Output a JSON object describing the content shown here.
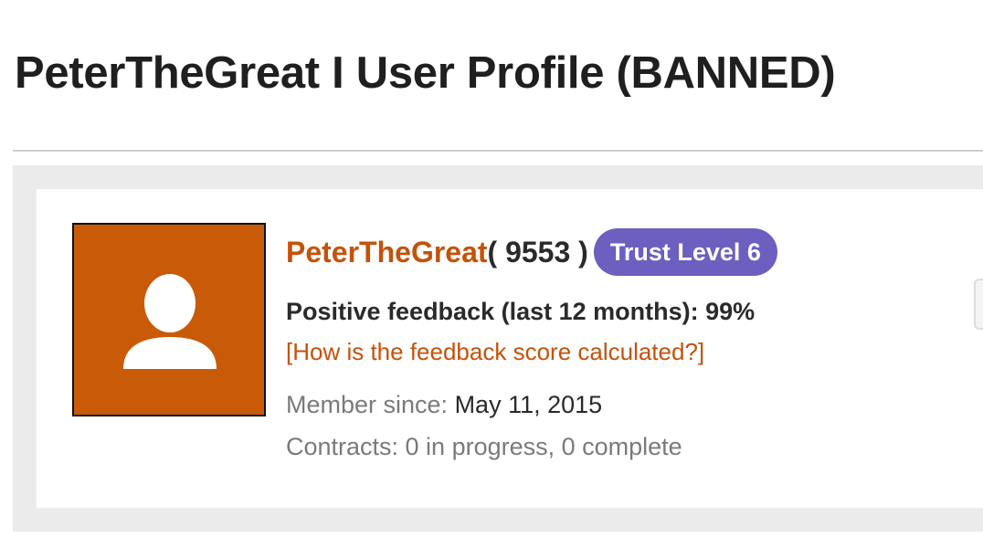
{
  "header": {
    "title": "PeterTheGreat I User Profile (BANNED)"
  },
  "profile": {
    "avatar_icon": "user-silhouette-icon",
    "avatar_color": "#c95a08",
    "username": "PeterTheGreat",
    "score_open": "( 9553 )",
    "trust_badge": "Trust Level 6",
    "trust_badge_color": "#6c5fbf",
    "feedback": "Positive feedback (last 12 months): 99%",
    "feedback_help_link": "[How is the feedback score calculated?]",
    "member_since_label": "Member since: ",
    "member_since_value": "May 11, 2015",
    "contracts": "Contracts: 0 in progress, 0 complete"
  },
  "colors": {
    "link": "#c4520a"
  }
}
